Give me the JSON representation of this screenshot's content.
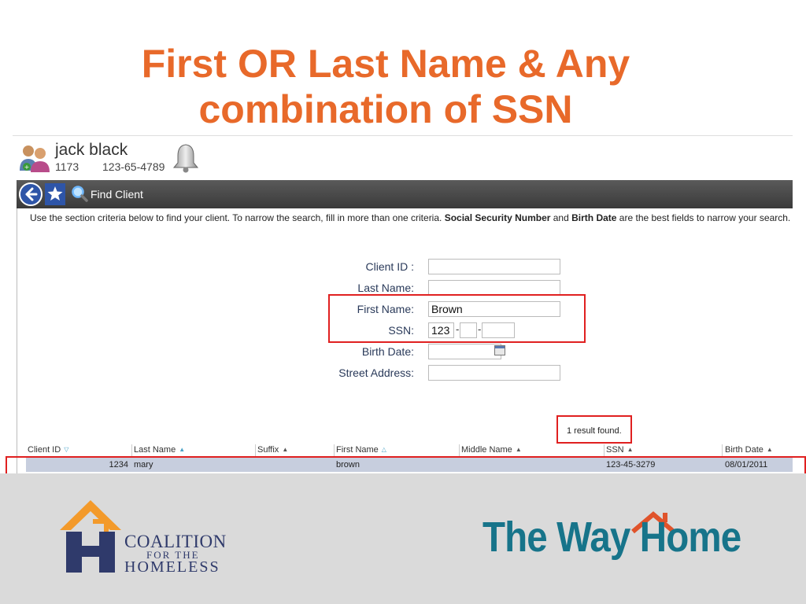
{
  "slide": {
    "title_line1": "First OR Last Name & Any",
    "title_line2": "combination of SSN",
    "title_color": "#e8692a"
  },
  "user": {
    "name": "jack black",
    "id": "1173",
    "ssn": "123-65-4789",
    "icons": [
      "users-icon",
      "bell-icon"
    ]
  },
  "toolbar": {
    "page_label": "Find Client",
    "icons": [
      "back-arrow-icon",
      "star-icon",
      "magnifier-icon"
    ]
  },
  "instructions": {
    "part1": "Use the section criteria below to find your client. To narrow the search, fill in more than one criteria. ",
    "bold1": "Social Security Number",
    "part2": " and ",
    "bold2": "Birth Date",
    "part3": " are the best fields to narrow your search."
  },
  "form": {
    "client_id_label": "Client ID :",
    "client_id_value": "",
    "last_name_label": "Last Name:",
    "last_name_value": "",
    "first_name_label": "First Name:",
    "first_name_value": "Brown",
    "ssn_label": "SSN:",
    "ssn_part1": "123",
    "ssn_part2": "",
    "ssn_part3": "",
    "ssn_separator": "-",
    "birth_date_label": "Birth Date:",
    "birth_date_value": "",
    "street_label": "Street Address:",
    "street_value": ""
  },
  "results": {
    "count_text": "1 result found.",
    "columns": [
      "Client ID",
      "Last Name",
      "Suffix",
      "First Name",
      "Middle Name",
      "SSN",
      "Birth Date"
    ],
    "rows": [
      {
        "client_id": "1234",
        "last_name": "mary",
        "suffix": "",
        "first_name": "brown",
        "middle_name": "",
        "ssn": "123-45-3279",
        "birth_date": "08/01/2011"
      }
    ]
  },
  "footer": {
    "coalition_line1": "COALITION",
    "coalition_line2": "FOR THE",
    "coalition_line3": "HOMELESS",
    "wayhome": "The Way Home",
    "colors": {
      "coalition_orange": "#f39a2b",
      "coalition_navy": "#2f3a6b",
      "wayhome_teal": "#17748a",
      "wayhome_roof": "#e0532b"
    }
  },
  "highlight_color": "#e02020"
}
